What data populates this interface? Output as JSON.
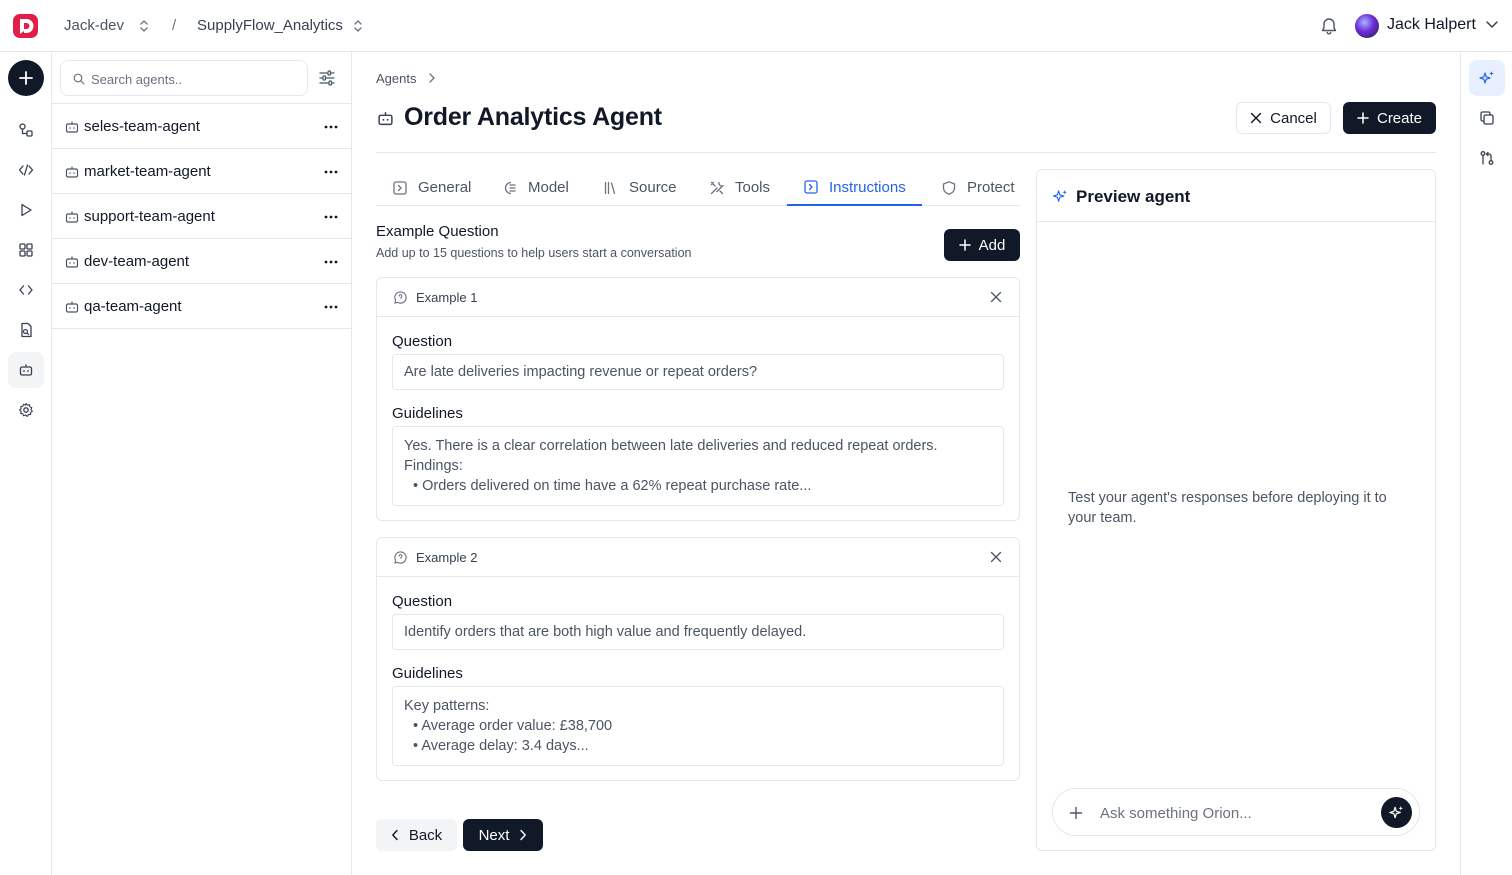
{
  "brand": {
    "accent": "#2563eb",
    "dark": "#111827",
    "logo_color": "#e11d48"
  },
  "topbar": {
    "workspace": "Jack-dev",
    "separator": "/",
    "project": "SupplyFlow_Analytics",
    "user_name": "Jack Halpert"
  },
  "rail": {
    "icons": [
      "plus-icon",
      "connections-icon",
      "code-icon",
      "play-icon",
      "grid-icon",
      "brackets-icon",
      "file-icon",
      "agent-icon",
      "gear-icon"
    ],
    "active": "agent-icon"
  },
  "agents_panel": {
    "search_placeholder": "Search agents..",
    "items": [
      {
        "name": "seles-team-agent"
      },
      {
        "name": "market-team-agent"
      },
      {
        "name": "support-team-agent"
      },
      {
        "name": "dev-team-agent"
      },
      {
        "name": "qa-team-agent"
      }
    ]
  },
  "main": {
    "breadcrumb": "Agents",
    "title": "Order Analytics Agent",
    "cancel_label": "Cancel",
    "create_label": "Create",
    "tabs": [
      {
        "label": "General",
        "icon": "general-icon"
      },
      {
        "label": "Model",
        "icon": "model-icon"
      },
      {
        "label": "Source",
        "icon": "source-icon"
      },
      {
        "label": "Tools",
        "icon": "tools-icon"
      },
      {
        "label": "Instructions",
        "icon": "instructions-icon",
        "active": true
      },
      {
        "label": "Protect",
        "icon": "shield-icon"
      }
    ],
    "example_section": {
      "title": "Example Question",
      "subtitle": "Add up to 15 questions to help users start a conversation",
      "add_label": "Add"
    },
    "examples": [
      {
        "label": "Example 1",
        "question_label": "Question",
        "question": "Are late deliveries impacting revenue or repeat orders?",
        "guidelines_label": "Guidelines",
        "guidelines_line1": "Yes. There is a clear correlation between late deliveries and reduced repeat orders.",
        "guidelines_line2": "Findings:",
        "guidelines_bullet": "Orders delivered on time have a 62% repeat purchase rate..."
      },
      {
        "label": "Example 2",
        "question_label": "Question",
        "question": "Identify orders that are both high value and frequently delayed.",
        "guidelines_label": "Guidelines",
        "guidelines_line1": "Key patterns:",
        "guidelines_bullet1": "Average order value: £38,700",
        "guidelines_bullet2": "Average delay: 3.4 days..."
      }
    ],
    "back_label": "Back",
    "next_label": "Next"
  },
  "preview": {
    "title": "Preview agent",
    "message": "Test your agent's responses before deploying it to your team.",
    "ask_placeholder": "Ask something Orion..."
  },
  "right_rail": {
    "icons": [
      "sparkle-icon",
      "copy-icon",
      "git-compare-icon"
    ],
    "active": "sparkle-icon"
  }
}
